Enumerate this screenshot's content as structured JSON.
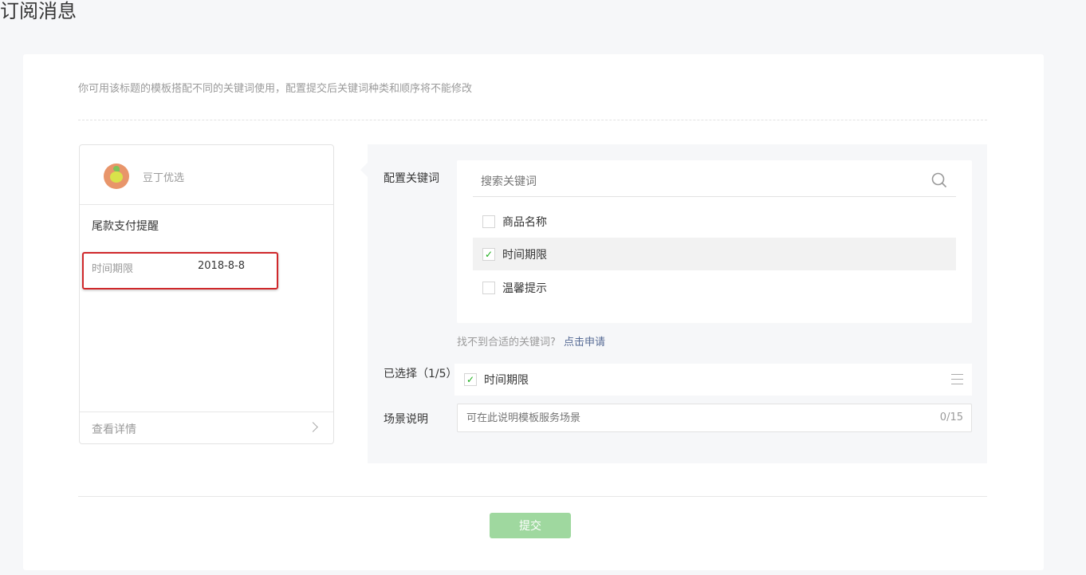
{
  "page": {
    "title": "订阅消息",
    "description": "你可用该标题的模板搭配不同的关键词使用，配置提交后关键词种类和顺序将不能修改"
  },
  "preview": {
    "account_name": "豆丁优选",
    "message_title": "尾款支付提醒",
    "field_label": "时间期限",
    "field_value": "2018-8-8",
    "details_link": "查看详情"
  },
  "config": {
    "keyword_label": "配置关键词",
    "search_placeholder": "搜索关键词",
    "keywords": [
      {
        "label": "商品名称",
        "checked": false
      },
      {
        "label": "时间期限",
        "checked": true
      },
      {
        "label": "温馨提示",
        "checked": false
      }
    ],
    "hint": "找不到合适的关键词?",
    "apply_link": "点击申请",
    "selected_label": "已选择（1/5）",
    "selected": [
      {
        "label": "时间期限"
      }
    ],
    "scene_label": "场景说明",
    "scene_placeholder": "可在此说明模板服务场景",
    "scene_counter": "0/15"
  },
  "submit_label": "提交",
  "colors": {
    "accent": "#1aad19",
    "link": "#576b95",
    "highlight": "#d0282b",
    "submit_disabled": "#9fd89f"
  }
}
